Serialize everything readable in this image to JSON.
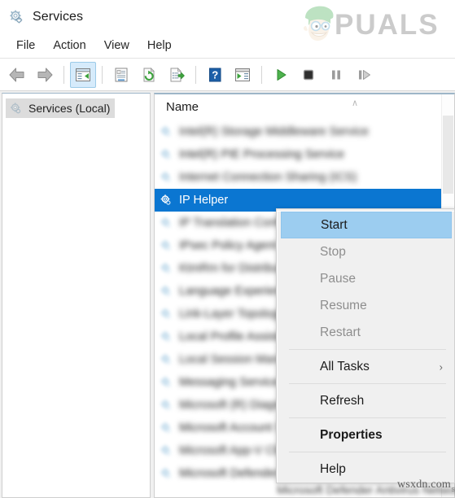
{
  "window": {
    "title": "Services",
    "title_icon": "services-gear-icon"
  },
  "menubar": {
    "items": [
      {
        "label": "File",
        "name": "menu-file"
      },
      {
        "label": "Action",
        "name": "menu-action"
      },
      {
        "label": "View",
        "name": "menu-view"
      },
      {
        "label": "Help",
        "name": "menu-help"
      }
    ]
  },
  "toolbar": {
    "buttons": [
      {
        "name": "back-icon",
        "tip": "Back"
      },
      {
        "name": "forward-icon",
        "tip": "Forward"
      },
      {
        "name": "show-hide-tree-icon",
        "tip": "Show/Hide Console Tree"
      },
      {
        "name": "properties-icon",
        "tip": "Properties"
      },
      {
        "name": "refresh-icon",
        "tip": "Refresh"
      },
      {
        "name": "export-list-icon",
        "tip": "Export List"
      },
      {
        "name": "help-icon",
        "tip": "Help"
      },
      {
        "name": "show-action-pane-icon",
        "tip": "Show/Hide Action Pane"
      },
      {
        "name": "start-service-icon",
        "tip": "Start Service"
      },
      {
        "name": "stop-service-icon",
        "tip": "Stop Service"
      },
      {
        "name": "pause-service-icon",
        "tip": "Pause Service"
      },
      {
        "name": "restart-service-icon",
        "tip": "Restart Service"
      }
    ]
  },
  "left_pane": {
    "node_label": "Services (Local)",
    "node_icon": "services-gear-icon"
  },
  "list": {
    "column_header": "Name",
    "sort_caret": "∧",
    "rows": [
      {
        "label": "Intel(R) Storage Middleware Service",
        "state": "blurred",
        "selected": false
      },
      {
        "label": "Intel(R) PIE Processing Service",
        "state": "blurred",
        "selected": false
      },
      {
        "label": "Internet Connection Sharing (ICS)",
        "state": "blurred",
        "selected": false
      },
      {
        "label": "IP Helper",
        "state": "clear",
        "selected": true
      },
      {
        "label": "IP Translation Configuration Service",
        "state": "blurred",
        "selected": false
      },
      {
        "label": "IPsec Policy Agent",
        "state": "blurred",
        "selected": false
      },
      {
        "label": "KtmRm for Distributed Transaction",
        "state": "blurred",
        "selected": false
      },
      {
        "label": "Language Experience Service",
        "state": "blurred",
        "selected": false
      },
      {
        "label": "Link-Layer Topology Discovery",
        "state": "blurred",
        "selected": false
      },
      {
        "label": "Local Profile Assistant Service",
        "state": "blurred",
        "selected": false
      },
      {
        "label": "Local Session Manager",
        "state": "blurred",
        "selected": false
      },
      {
        "label": "Messaging Service",
        "state": "blurred",
        "selected": false
      },
      {
        "label": "Microsoft (R) Diagnostics Hub",
        "state": "blurred",
        "selected": false
      },
      {
        "label": "Microsoft Account Sign-in Assistant",
        "state": "blurred",
        "selected": false
      },
      {
        "label": "Microsoft App-V Client",
        "state": "blurred",
        "selected": false
      },
      {
        "label": "Microsoft Defender Antivirus",
        "state": "blurred",
        "selected": false
      }
    ]
  },
  "context_menu": {
    "items": [
      {
        "label": "Start",
        "state": "highlight",
        "submenu": false
      },
      {
        "label": "Stop",
        "state": "disabled",
        "submenu": false
      },
      {
        "label": "Pause",
        "state": "disabled",
        "submenu": false
      },
      {
        "label": "Resume",
        "state": "disabled",
        "submenu": false
      },
      {
        "label": "Restart",
        "state": "disabled",
        "submenu": false
      },
      {
        "label": "All Tasks",
        "state": "normal",
        "submenu": true,
        "submenu_arrow": "›"
      },
      {
        "label": "Refresh",
        "state": "normal",
        "submenu": false
      },
      {
        "label": "Properties",
        "state": "bold",
        "submenu": false
      },
      {
        "label": "Help",
        "state": "normal",
        "submenu": false
      }
    ]
  },
  "watermarks": {
    "brand": "APPUALS",
    "brand_text_visible": "PUALS",
    "site": "wsxdn.com",
    "site_edge": "s"
  },
  "background_text": {
    "obscured_row": "Microsoft Defender Antivirus Network Insp"
  },
  "colors": {
    "selection_blue": "#0b76d1",
    "menu_highlight": "#9ccdf0",
    "toolbar_active": "#d6ebfb",
    "window_chrome": "#f0f0f0",
    "brand_green": "#6ec07a",
    "brand_gray": "#8e8e8e"
  }
}
